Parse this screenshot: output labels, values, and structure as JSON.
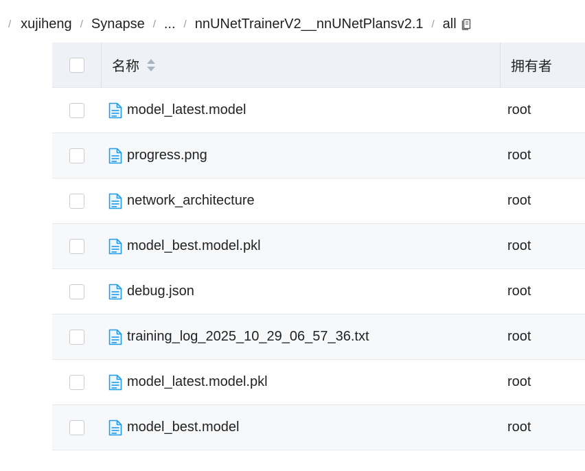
{
  "breadcrumb": {
    "items": [
      "xujiheng",
      "Synapse",
      "...",
      "nnUNetTrainerV2__nnUNetPlansv2.1",
      "all"
    ],
    "separator": "/",
    "copy_icon": "copy-icon"
  },
  "table": {
    "headers": {
      "name": "名称",
      "owner": "拥有者"
    },
    "rows": [
      {
        "name": "model_latest.model",
        "owner": "root"
      },
      {
        "name": "progress.png",
        "owner": "root"
      },
      {
        "name": "network_architecture",
        "owner": "root"
      },
      {
        "name": "model_best.model.pkl",
        "owner": "root"
      },
      {
        "name": "debug.json",
        "owner": "root"
      },
      {
        "name": "training_log_2025_10_29_06_57_36.txt",
        "owner": "root"
      },
      {
        "name": "model_latest.model.pkl",
        "owner": "root"
      },
      {
        "name": "model_best.model",
        "owner": "root"
      }
    ]
  },
  "colors": {
    "header_bg": "#eef1f5",
    "alt_row_bg": "#f6f8fa",
    "file_icon": "#1e9be9"
  }
}
